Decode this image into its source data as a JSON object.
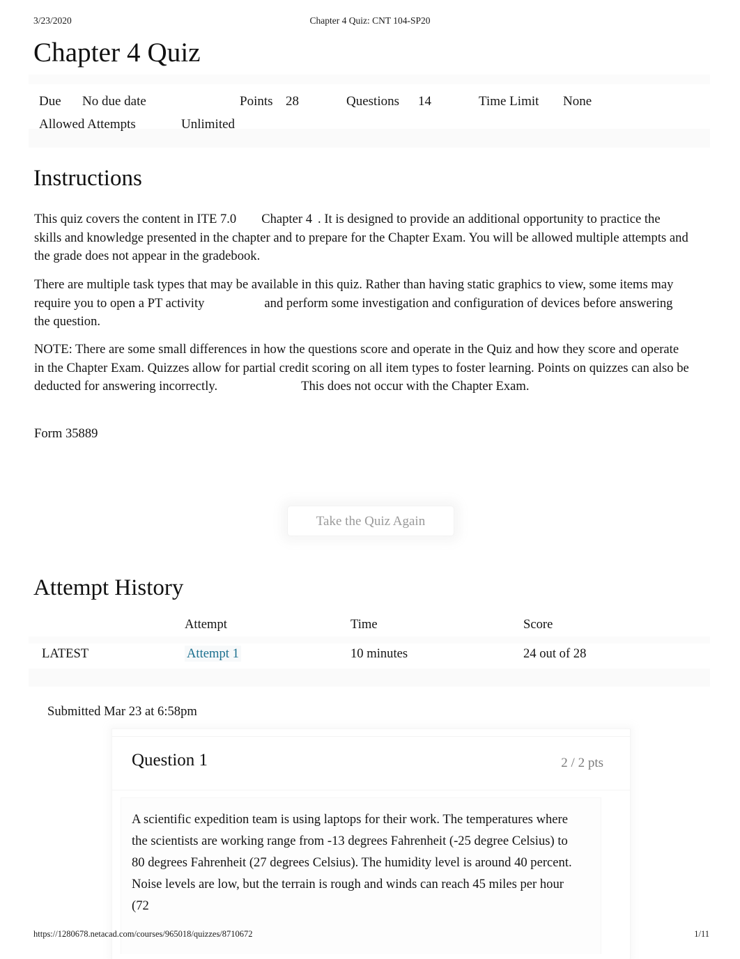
{
  "print": {
    "date": "3/23/2020",
    "doc_title": "Chapter 4 Quiz: CNT 104-SP20",
    "footer_url": "https://1280678.netacad.com/courses/965018/quizzes/8710672",
    "footer_page": "1/11"
  },
  "quiz": {
    "title": "Chapter 4 Quiz",
    "meta": {
      "due_label": "Due",
      "due_value": "No due date",
      "points_label": "Points",
      "points_value": "28",
      "questions_label": "Questions",
      "questions_value": "14",
      "time_limit_label": "Time Limit",
      "time_limit_value": "None",
      "allowed_attempts_label": "Allowed Attempts",
      "allowed_attempts_value": "Unlimited"
    }
  },
  "instructions": {
    "heading": "Instructions",
    "p1_a": "This quiz covers the content in ITE 7.0",
    "p1_b": "Chapter 4",
    "p1_c": ". It is designed to provide an additional opportunity to practice the skills and knowledge presented in the chapter and to prepare for the Chapter Exam. You will be allowed multiple attempts and the grade does not appear in the gradebook.",
    "p2_a": "There are multiple task types that may be available in this quiz. Rather than having static graphics to view,  some items may require you to open a PT activity",
    "p2_b": "and perform some investigation and configuration of devices before answering the question.",
    "p3_a": "NOTE:  There are some small differences in how the questions score and operate in the Quiz and how they score and operate in the Chapter Exam. Quizzes allow for partial credit scoring on all item types to foster learning.   Points on quizzes can also be deducted for answering incorrectly.",
    "p3_b": "This does not occur with the Chapter Exam.",
    "form": "Form 35889"
  },
  "actions": {
    "retake_label": "Take the Quiz Again"
  },
  "attempt_history": {
    "heading": "Attempt History",
    "columns": [
      "",
      "Attempt",
      "Time",
      "Score"
    ],
    "rows": [
      {
        "flag": "LATEST",
        "attempt": "Attempt 1",
        "time": "10 minutes",
        "score": "24 out of 28"
      }
    ]
  },
  "submission": {
    "submitted_text": "Submitted Mar 23 at 6:58pm"
  },
  "question": {
    "title": "Question 1",
    "points": "2 / 2 pts",
    "body": "A scientific expedition team is using laptops for their work. The temperatures where the scientists are working range from -13 degrees Fahrenheit (-25 degree Celsius) to 80 degrees Fahrenheit (27 degrees Celsius). The humidity level is around 40 percent. Noise levels are low, but the terrain is rough and winds can reach 45 miles per hour (72"
  },
  "colors": {
    "link": "#1a6f8e",
    "text": "#141414",
    "muted": "#7b7b7b",
    "disabled": "#9a9a9a"
  }
}
